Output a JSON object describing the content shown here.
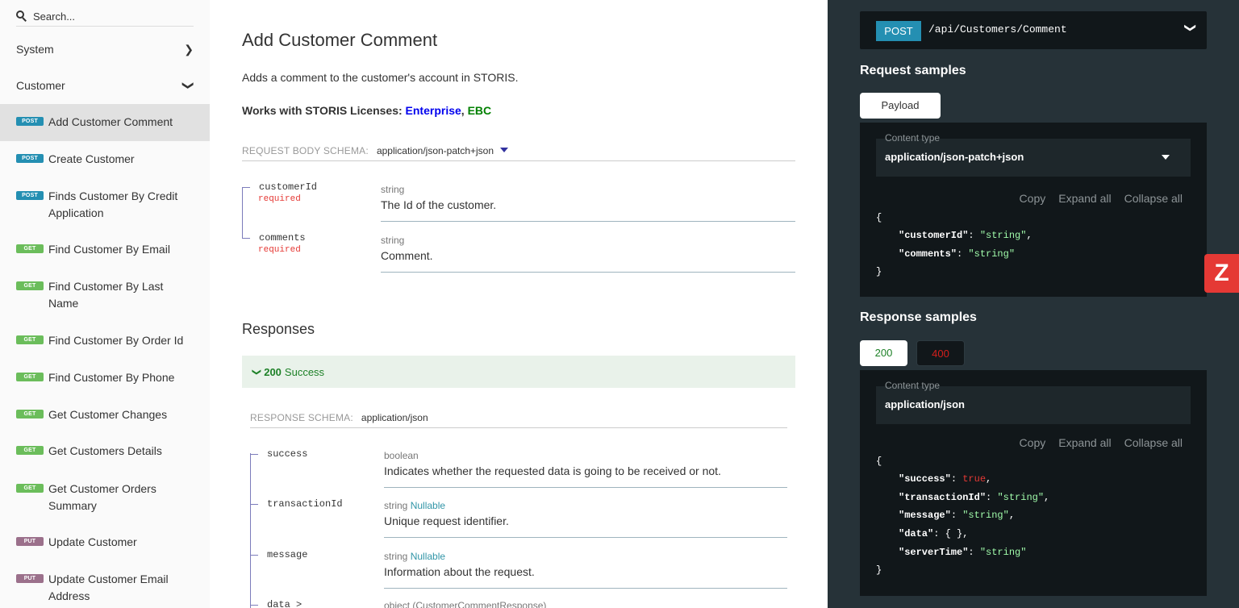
{
  "sidebar": {
    "search_placeholder": "Search...",
    "groups": [
      {
        "label": "System",
        "icon": "chevron-right-icon"
      },
      {
        "label": "Customer",
        "icon": "chevron-down-icon"
      }
    ],
    "items": [
      {
        "method": "POST",
        "label": "Add Customer Comment",
        "active": true
      },
      {
        "method": "POST",
        "label": "Create Customer"
      },
      {
        "method": "POST",
        "label": "Finds Customer By Credit Application"
      },
      {
        "method": "GET",
        "label": "Find Customer By Email"
      },
      {
        "method": "GET",
        "label": "Find Customer By Last Name"
      },
      {
        "method": "GET",
        "label": "Find Customer By Order Id"
      },
      {
        "method": "GET",
        "label": "Find Customer By Phone"
      },
      {
        "method": "GET",
        "label": "Get Customer Changes"
      },
      {
        "method": "GET",
        "label": "Get Customers Details"
      },
      {
        "method": "GET",
        "label": "Get Customer Orders Summary"
      },
      {
        "method": "PUT",
        "label": "Update Customer"
      },
      {
        "method": "PUT",
        "label": "Update Customer Email Address"
      }
    ]
  },
  "main": {
    "title": "Add Customer Comment",
    "description": "Adds a comment to the customer's account in STORIS.",
    "licenses_prefix": "Works with STORIS Licenses: ",
    "license_enterprise": "Enterprise",
    "license_sep": ", ",
    "license_ebc": "EBC",
    "request_schema_label": "REQUEST BODY SCHEMA:",
    "request_schema_value": "application/json-patch+json",
    "request_fields": [
      {
        "name": "customerId",
        "required": "required",
        "type": "string",
        "description": "The Id of the customer."
      },
      {
        "name": "comments",
        "required": "required",
        "type": "string",
        "description": "Comment."
      }
    ],
    "responses_title": "Responses",
    "response_code": "200",
    "response_text": "Success",
    "response_schema_label": "RESPONSE SCHEMA:",
    "response_schema_value": "application/json",
    "response_fields": [
      {
        "name": "success",
        "type": "boolean",
        "nullable": "",
        "description": "Indicates whether the requested data is going to be received or not."
      },
      {
        "name": "transactionId",
        "type": "string",
        "nullable": "Nullable",
        "description": "Unique request identifier."
      },
      {
        "name": "message",
        "type": "string",
        "nullable": "Nullable",
        "description": "Information about the request."
      },
      {
        "name": "data >",
        "type": "object (CustomerCommentResponse)",
        "nullable": "",
        "description": ""
      }
    ]
  },
  "right": {
    "method": "POST",
    "path": "/api/Customers/Comment",
    "request_samples_title": "Request samples",
    "request_tab": "Payload",
    "content_type_label": "Content type",
    "request_content_type": "application/json-patch+json",
    "copy": "Copy",
    "expand_all": "Expand all",
    "collapse_all": "Collapse all",
    "request_code": {
      "open": "{",
      "close": "}",
      "lines": [
        {
          "key": "\"customerId\"",
          "value": "\"string\"",
          "trail": ","
        },
        {
          "key": "\"comments\"",
          "value": "\"string\"",
          "trail": ""
        }
      ]
    },
    "response_samples_title": "Response samples",
    "response_tab_200": "200",
    "response_tab_400": "400",
    "response_content_type": "application/json",
    "response_code": {
      "open": "{",
      "close": "}",
      "lines": [
        {
          "key": "\"success\"",
          "value": "true",
          "trail": ",",
          "bool": true
        },
        {
          "key": "\"transactionId\"",
          "value": "\"string\"",
          "trail": ","
        },
        {
          "key": "\"message\"",
          "value": "\"string\"",
          "trail": ","
        },
        {
          "key": "\"data\"",
          "value": "{ }",
          "trail": ",",
          "plain": true
        },
        {
          "key": "\"serverTime\"",
          "value": "\"string\"",
          "trail": ""
        }
      ]
    }
  },
  "colors": {
    "post": "#248fb2",
    "get": "#6bbd5b",
    "put": "#9b708b",
    "right_panel_bg": "#263238",
    "success_green": "#1d8127"
  },
  "logo_text": "Z"
}
